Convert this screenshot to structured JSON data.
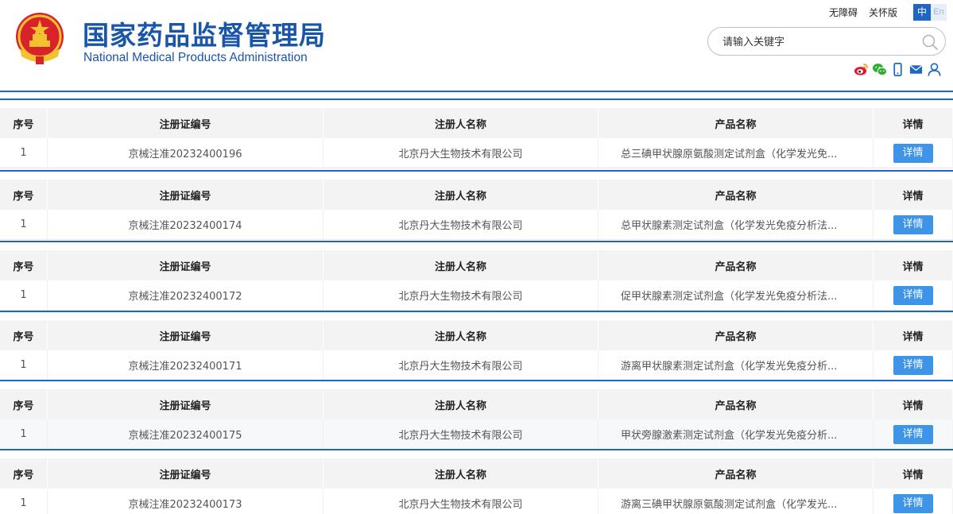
{
  "header": {
    "title_cn": "国家药品监督管理局",
    "title_en": "National Medical Products Administration",
    "links": [
      "无障碍",
      "关怀版"
    ],
    "lang_cn": "中",
    "lang_en": "En",
    "search_placeholder": "请输入关键字",
    "social_icons": [
      "weibo-icon",
      "wechat-icon",
      "mobile-icon",
      "mail-icon",
      "user-icon"
    ],
    "colors": {
      "brand": "#1a56a8",
      "accent": "#1e66c3",
      "button": "#3e95e8"
    }
  },
  "columns": [
    "序号",
    "注册证编号",
    "注册人名称",
    "产品名称",
    "详情"
  ],
  "records": [
    {
      "index": "1",
      "cert_no": "京械注准20232400196",
      "registrant": "北京丹大生物技术有限公司",
      "product": "总三碘甲状腺原氨酸测定试剂盒（化学发光免...",
      "detail": "详情"
    },
    {
      "index": "1",
      "cert_no": "京械注准20232400174",
      "registrant": "北京丹大生物技术有限公司",
      "product": "总甲状腺素测定试剂盒（化学发光免疫分析法...",
      "detail": "详情"
    },
    {
      "index": "1",
      "cert_no": "京械注准20232400172",
      "registrant": "北京丹大生物技术有限公司",
      "product": "促甲状腺素测定试剂盒（化学发光免疫分析法...",
      "detail": "详情"
    },
    {
      "index": "1",
      "cert_no": "京械注准20232400171",
      "registrant": "北京丹大生物技术有限公司",
      "product": "游离甲状腺素测定试剂盒（化学发光免疫分析...",
      "detail": "详情"
    },
    {
      "index": "1",
      "cert_no": "京械注准20232400175",
      "registrant": "北京丹大生物技术有限公司",
      "product": "甲状旁腺激素测定试剂盒（化学发光免疫分析...",
      "detail": "详情"
    },
    {
      "index": "1",
      "cert_no": "京械注准20232400173",
      "registrant": "北京丹大生物技术有限公司",
      "product": "游离三碘甲状腺原氨酸测定试剂盒（化学发光...",
      "detail": "详情"
    }
  ]
}
